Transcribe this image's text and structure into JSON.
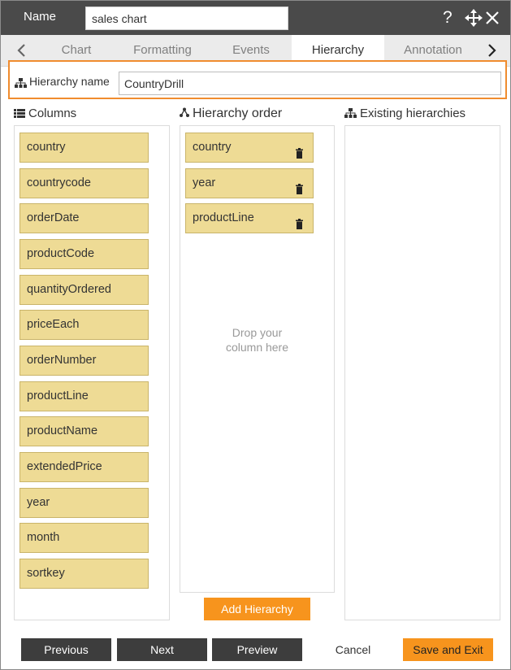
{
  "header": {
    "name_label": "Name",
    "name_value": "sales chart",
    "help_icon": "?",
    "move_icon": "✥",
    "close_icon": "✕"
  },
  "tabs": {
    "prev_icon": "‹",
    "next_icon": "›",
    "items": [
      {
        "label": "Chart"
      },
      {
        "label": "Formatting"
      },
      {
        "label": "Events"
      },
      {
        "label": "Hierarchy",
        "active": true
      },
      {
        "label": "Annotation"
      }
    ]
  },
  "hierarchy_name": {
    "label": "Hierarchy name",
    "value": "CountryDrill"
  },
  "columns_panel": {
    "title": "Columns",
    "items": [
      "country",
      "countrycode",
      "orderDate",
      "productCode",
      "quantityOrdered",
      "priceEach",
      "orderNumber",
      "productLine",
      "productName",
      "extendedPrice",
      "year",
      "month",
      "sortkey"
    ]
  },
  "order_panel": {
    "title": "Hierarchy order",
    "items": [
      "country",
      "year",
      "productLine"
    ],
    "drop_hint": "Drop your column here"
  },
  "existing_panel": {
    "title": "Existing hierarchies"
  },
  "add_button": "Add Hierarchy",
  "footer": {
    "previous": "Previous",
    "next": "Next",
    "preview": "Preview",
    "cancel": "Cancel",
    "save_exit": "Save and Exit"
  },
  "colors": {
    "accent": "#f7941d",
    "chip": "#eedb95",
    "header": "#4a4a4a"
  }
}
